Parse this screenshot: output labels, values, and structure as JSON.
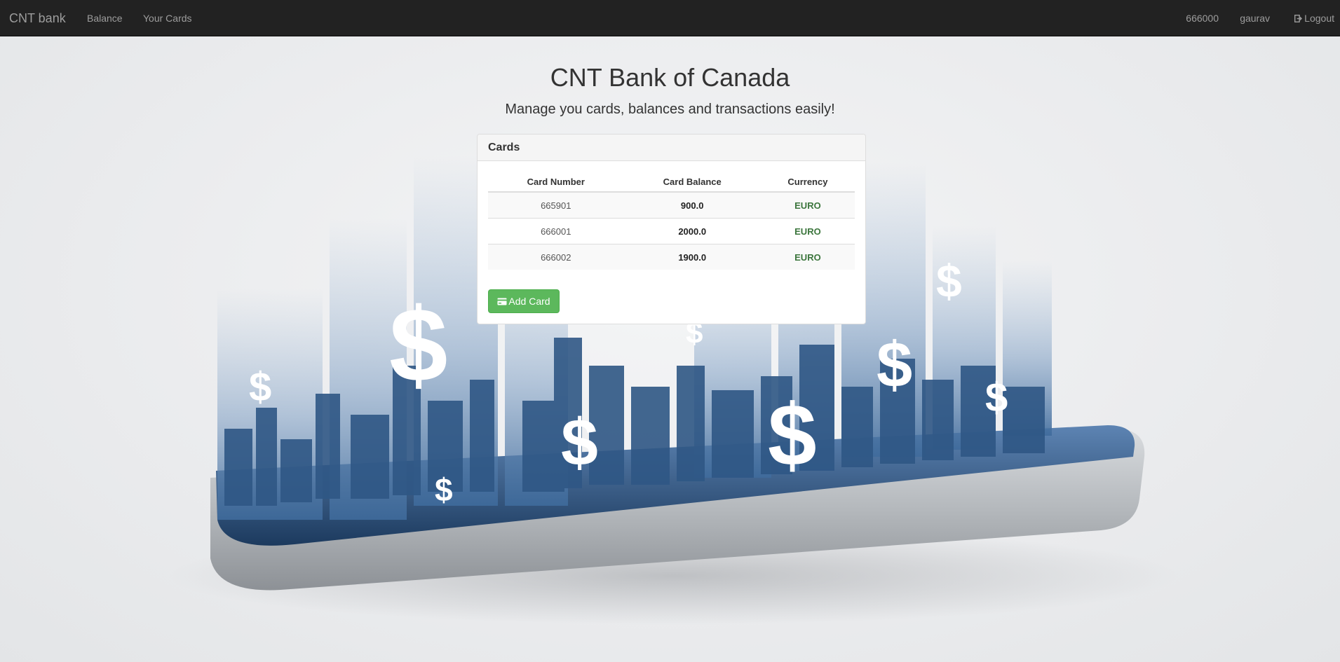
{
  "navbar": {
    "brand": "CNT bank",
    "links": {
      "balance": "Balance",
      "cards": "Your Cards"
    },
    "account_number": "666000",
    "username": "gaurav",
    "logout": "Logout"
  },
  "header": {
    "title": "CNT Bank of Canada",
    "subtitle": "Manage you cards, balances and transactions easily!"
  },
  "panel": {
    "title": "Cards",
    "columns": [
      "Card Number",
      "Card Balance",
      "Currency"
    ],
    "rows": [
      {
        "number": "665901",
        "balance": "900.0",
        "currency": "EURO"
      },
      {
        "number": "666001",
        "balance": "2000.0",
        "currency": "EURO"
      },
      {
        "number": "666002",
        "balance": "1900.0",
        "currency": "EURO"
      }
    ],
    "add_button": "Add Card"
  },
  "colors": {
    "navbar_bg": "#222222",
    "success_green": "#5cb85c",
    "currency_green": "#3c763d"
  },
  "icons": {
    "logout": "logout-icon",
    "add_card": "credit-card-icon"
  }
}
